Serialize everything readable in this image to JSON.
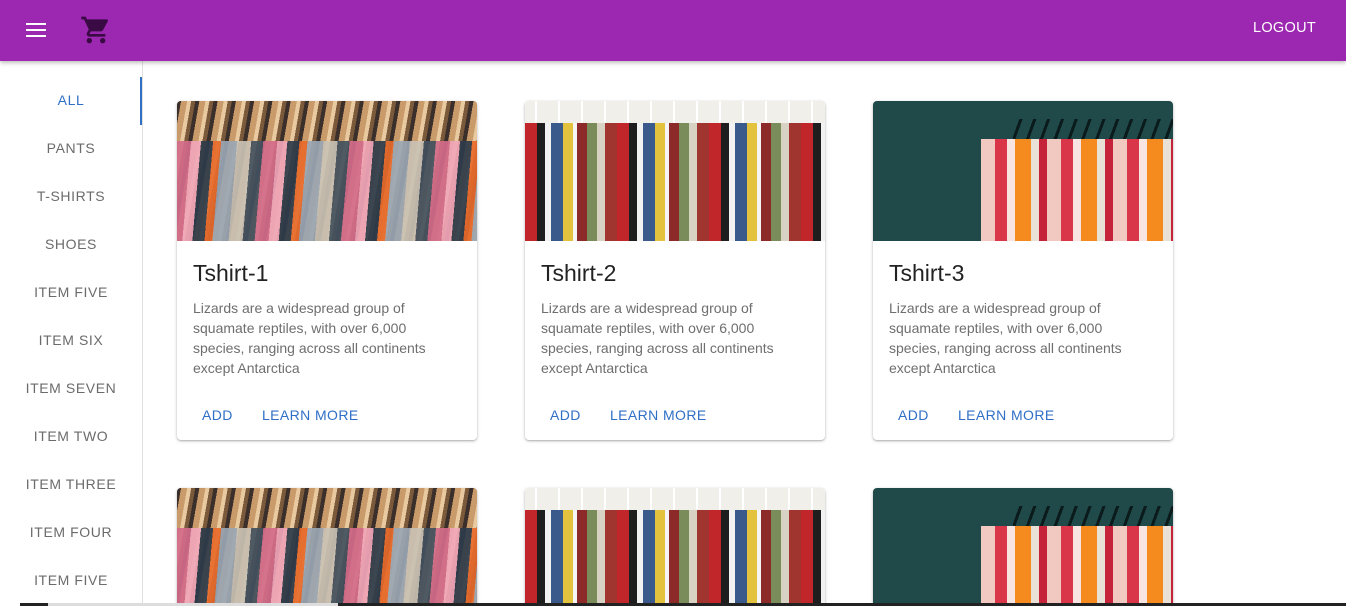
{
  "colors": {
    "appbar": "#9c27b0",
    "accent": "#2f6fc6"
  },
  "appbar": {
    "menu_icon": "menu-icon",
    "cart_icon": "shopping-cart-icon",
    "logout_label": "LOGOUT"
  },
  "sidebar": {
    "active_index": 0,
    "items": [
      {
        "label": "ALL"
      },
      {
        "label": "PANTS"
      },
      {
        "label": "T-SHIRTS"
      },
      {
        "label": "SHOES"
      },
      {
        "label": "ITEM FIVE"
      },
      {
        "label": "ITEM SIX"
      },
      {
        "label": "ITEM SEVEN"
      },
      {
        "label": "ITEM TWO"
      },
      {
        "label": "ITEM THREE"
      },
      {
        "label": "ITEM FOUR"
      },
      {
        "label": "ITEM FIVE"
      }
    ]
  },
  "cards": [
    {
      "title": "Tshirt-1",
      "description": "Lizards are a widespread group of squamate reptiles, with over 6,000 species, ranging across all continents except Antarctica",
      "add_label": "ADD",
      "learn_label": "LEARN MORE"
    },
    {
      "title": "Tshirt-2",
      "description": "Lizards are a widespread group of squamate reptiles, with over 6,000 species, ranging across all continents except Antarctica",
      "add_label": "ADD",
      "learn_label": "LEARN MORE"
    },
    {
      "title": "Tshirt-3",
      "description": "Lizards are a widespread group of squamate reptiles, with over 6,000 species, ranging across all continents except Antarctica",
      "add_label": "ADD",
      "learn_label": "LEARN MORE"
    }
  ]
}
